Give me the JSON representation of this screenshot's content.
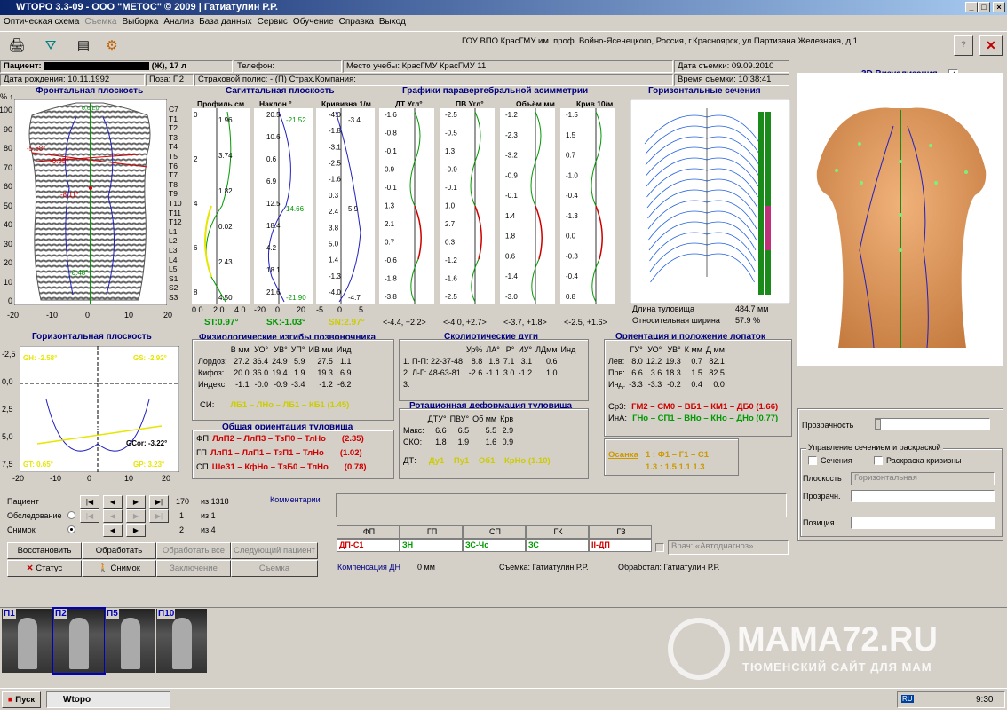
{
  "window": {
    "title": "WTOPO 3.3-09 - ООО \"МЕТОС\" © 2009   |  Гатиатулин Р.Р."
  },
  "menu": [
    "Оптическая схема",
    "Съемка",
    "Выборка",
    "Анализ",
    "База данных",
    "Сервис",
    "Обучение",
    "Справка",
    "Выход"
  ],
  "toolbar": {
    "org": "ГОУ ВПО КрасГМУ им. проф. Войно-Ясенецкого, Россия, г.Красноярск, ул.Партизана Железняка, д.1",
    "help": "?",
    "close": "✕"
  },
  "patient": {
    "label": "Пациент:",
    "info": "(Ж), 17 л",
    "phone": "Телефон:",
    "study_place": "Место учебы: КрасГМУ КрасГМУ 11",
    "shoot_date": "Дата съемки: 09.09.2010",
    "birth": "Дата рождения: 10.11.1992",
    "pose": "Поза:  П2",
    "insurance": "Страховой полис:  - (П) Страх.Компания:",
    "shoot_time": "Время съемки: 10:38:41"
  },
  "frontal": {
    "title": "Фронтальная плоскость",
    "y_axis": [
      "100",
      "90",
      "80",
      "70",
      "60",
      "50",
      "40",
      "30",
      "20",
      "10",
      "0"
    ],
    "y_unit": "% ↑",
    "x_axis": [
      "-20",
      "-10",
      "0",
      "10",
      "20"
    ],
    "vert": [
      "C7",
      "T1",
      "T2",
      "T3",
      "T4",
      "T5",
      "T6",
      "T7",
      "T8",
      "T9",
      "T10",
      "T11",
      "T12",
      "L1",
      "L2",
      "L3",
      "L4",
      "L5",
      "S1",
      "S2",
      "S3"
    ],
    "ann1": "-5.68°",
    "ann2": "-6.35°",
    "ann3": "-8.11°",
    "ann4": "-0.48°",
    "top": "0.0 L0"
  },
  "sagittal": {
    "title": "Сагиттальная плоскость",
    "cols": [
      {
        "h": "Профиль см",
        "ticks": [
          "0",
          "2",
          "4",
          "6",
          "8"
        ],
        "vals": [
          "1.96",
          "3.74",
          "1.82",
          "0.02",
          "2.43",
          "4.50"
        ],
        "axis": [
          "0.0",
          "2.0",
          "4.0"
        ],
        "foot": "ST:0.97°"
      },
      {
        "h": "Наклон °",
        "ticks": [
          "20.5",
          "10.6",
          "0.6",
          "6.9",
          "12.5",
          "18.4",
          "4.2",
          "18.1",
          "21.6"
        ],
        "vals": [
          "-21.52",
          "14.66",
          "-21.90"
        ],
        "axis": [
          "-20",
          "0",
          "20"
        ],
        "foot": "SK:-1.03°"
      },
      {
        "h": "Кривизна 1/м",
        "ticks": [
          "-4.0",
          "-1.8",
          "-3.1",
          "-2.5",
          "-1.6",
          "0.3",
          "2.4",
          "3.8",
          "5.0",
          "1.4",
          "-1.3",
          "-4.0"
        ],
        "vals": [
          "-3.4",
          "5.9",
          "-4.7"
        ],
        "axis": [
          "-5",
          "0",
          "5"
        ],
        "foot": "SN:2.97°"
      }
    ]
  },
  "parav": {
    "title": "Графики паравертебральной асимметрии",
    "cols": [
      {
        "h": "ДТ Угл°",
        "ticks": [
          "-1.6",
          "-0.8",
          "-0.1",
          "0.9",
          "-0.1",
          "1.3",
          "2.1",
          "0.7",
          "-0.6",
          "-1.8",
          "-3.8"
        ],
        "range": "<-4.4, +2.2>"
      },
      {
        "h": "ПВ Угл°",
        "ticks": [
          "-2.5",
          "-0.5",
          "1.3",
          "-0.9",
          "-0.1",
          "1.0",
          "2.7",
          "0.3",
          "-1.2",
          "-1.6",
          "-2.5"
        ],
        "range": "<-4.0, +2.7>"
      },
      {
        "h": "Объём мм",
        "ticks": [
          "-1.2",
          "-2.3",
          "-3.2",
          "-0.9",
          "-0.1",
          "1.4",
          "1.8",
          "0.6",
          "-1.4",
          "-3.0"
        ],
        "range": "<-3.7, +1.8>"
      },
      {
        "h": "Крив 10/м",
        "ticks": [
          "-1.5",
          "1.5",
          "0.7",
          "-1.0",
          "-0.4",
          "-1.3",
          "0.0",
          "-0.3",
          "-0.4",
          "0.8"
        ],
        "range": "<-2.5, +1.6>"
      }
    ]
  },
  "horizontal_sections": {
    "title": "Горизонтальные сечения",
    "length_lbl": "Длина туловища",
    "length_val": "484.7 мм",
    "width_lbl": "Относительная ширина",
    "width_val": "57.9 %"
  },
  "viz3d": {
    "title": "3D Визуализация",
    "checked": "✓"
  },
  "hplane": {
    "title": "Горизонтальная плоскость",
    "y": [
      "-2,5",
      "0,0",
      "2,5",
      "5,0",
      "7,5"
    ],
    "x": [
      "-20",
      "-10",
      "0",
      "10",
      "20"
    ],
    "gh": "GH: -2.58°",
    "gs": "GS: -2.92°",
    "gcor": "GCor: -3.22°",
    "gt": "GT: 0.65°",
    "gp": "GP: 3.23°"
  },
  "physio": {
    "title": "Физиологические изгибы позвоночника",
    "headers": [
      "",
      "В мм",
      "УО°",
      "УВ°",
      "УП°",
      "ИВ мм",
      "Инд"
    ],
    "rows": [
      [
        "Лордоз:",
        "27.2",
        "36.4",
        "24.9",
        "5.9",
        "27.5",
        "1.1"
      ],
      [
        "Кифоз:",
        "20.0",
        "36.0",
        "19.4",
        "1.9",
        "19.3",
        "6.9"
      ],
      [
        "Индекс:",
        "-1.1",
        "-0.0",
        "-0.9",
        "-3.4",
        "-1.2",
        "-6.2"
      ]
    ],
    "si": "СИ:",
    "si_vals": "ЛБ1 – ЛНо – ЛБ1 – КБ1  (1.45)"
  },
  "orient": {
    "title": "Общая ориентация туловища",
    "rows": [
      {
        "k": "ФП",
        "v": "ЛлП2 – ЛлП3 – ТзП0 – ТлНо",
        "n": "(2.35)"
      },
      {
        "k": "ГП",
        "v": "ЛлП1 – ЛлП1 – ТзП1 – ТлНо",
        "n": "(1.02)"
      },
      {
        "k": "СП",
        "v": "ШеЗ1 – КфНо – ТзБ0 – ТлНо",
        "n": "(0.78)"
      }
    ]
  },
  "scol": {
    "title": "Сколиотические дуги",
    "headers": [
      "",
      "Ур%",
      "ЛА°",
      "Р°",
      "ИУ°",
      "ЛДмм",
      "Инд"
    ],
    "rows": [
      [
        "1. П-П: 22-37-48",
        "8.8",
        "1.8",
        "7.1",
        "3.1",
        "0.6"
      ],
      [
        "2. Л-Г: 48-63-81",
        "-2.6",
        "-1.1",
        "3.0",
        "-1.2",
        "1.0"
      ],
      [
        "3.",
        "",
        "",
        "",
        "",
        ""
      ]
    ]
  },
  "rot": {
    "title": "Ротационная деформация туловища",
    "headers": [
      "",
      "ДТУ°",
      "ПВУ°",
      "Об мм",
      "Крв"
    ],
    "rows": [
      [
        "Макс:",
        "6.6",
        "6.5",
        "5.5",
        "2.9"
      ],
      [
        "СКО:",
        "1.8",
        "1.9",
        "1.6",
        "0.9"
      ]
    ],
    "dt": "ДТ:",
    "dt_vals": "Ду1 – Пу1 – Об1 – КрНо (1.10)"
  },
  "scap": {
    "title": "Ориентация и положение лопаток",
    "headers": [
      "",
      "ГУ°",
      "УО°",
      "УВ°",
      "К мм",
      "Д мм"
    ],
    "rows": [
      [
        "Лев:",
        "8.0",
        "12.2",
        "19.3",
        "0.7",
        "82.1"
      ],
      [
        "Прв:",
        "6.6",
        "3.6",
        "18.3",
        "1.5",
        "82.5"
      ],
      [
        "Инд:",
        "-3.3",
        "-3.3",
        "-0.2",
        "0.4",
        "0.0"
      ]
    ],
    "cp": "Ср3:",
    "cp_vals": "ГМ2 – СМ0 – ВБ1 – КМ1 – ДБ0 (1.66)",
    "ind": "ИнА:",
    "ind_vals": "ГНо – СП1 – ВНо – КНо – ДНо (0.77)",
    "posture": "Осанка",
    "posture_vals": "1 : Ф1 – Г1 – С1",
    "posture_vals2": "1.3 : 1.5   1.1   1.3"
  },
  "right": {
    "transp": "Прозрачность",
    "group": "Управление сечением и раскраской",
    "sections": "Сечения",
    "color_curv": "Раскраска кривизны",
    "plane_lbl": "Плоскость",
    "plane_val": "Горизонтальная",
    "transp2": "Прозрачн.",
    "position": "Позиция"
  },
  "nav": {
    "patient": "Пациент",
    "exam": "Обследование",
    "shot": "Снимок",
    "p_num": "170",
    "p_of": "из 1318",
    "e_num": "1",
    "e_of": "из 1",
    "s_num": "2",
    "s_of": "из 4"
  },
  "buttons": {
    "restore": "Восстановить",
    "process": "Обработать",
    "process_all": "Обработать все",
    "next_patient": "Следующий пациент",
    "status": "Статус",
    "snapshot": "Снимок",
    "conclusion": "Заключение",
    "shoot": "Съемка"
  },
  "comments": {
    "label": "Комментарии"
  },
  "diag": {
    "headers": [
      "ФП",
      "ГП",
      "СП",
      "ГК",
      "ГЗ"
    ],
    "vals": [
      "ДП-С1",
      "ЗН",
      "ЗС-Чс",
      "ЗС",
      "II-ДП"
    ],
    "doc": "Врач: «Автодиагноз»",
    "comp": "Компенсация ДН",
    "comp_val": "0 мм",
    "shot_by": "Съемка: Гатиатулин Р.Р.",
    "proc_by": "Обработал: Гатиатулин Р.Р."
  },
  "thumbs": [
    "П1",
    "П2",
    "П5",
    "П10"
  ],
  "watermark": {
    "big": "MAMA72.RU",
    "small": "ТЮМЕНСКИЙ САЙТ ДЛЯ МАМ"
  },
  "taskbar": {
    "start": "Пуск",
    "app": "Wtopo",
    "lang": "RU",
    "time": "9:30"
  }
}
